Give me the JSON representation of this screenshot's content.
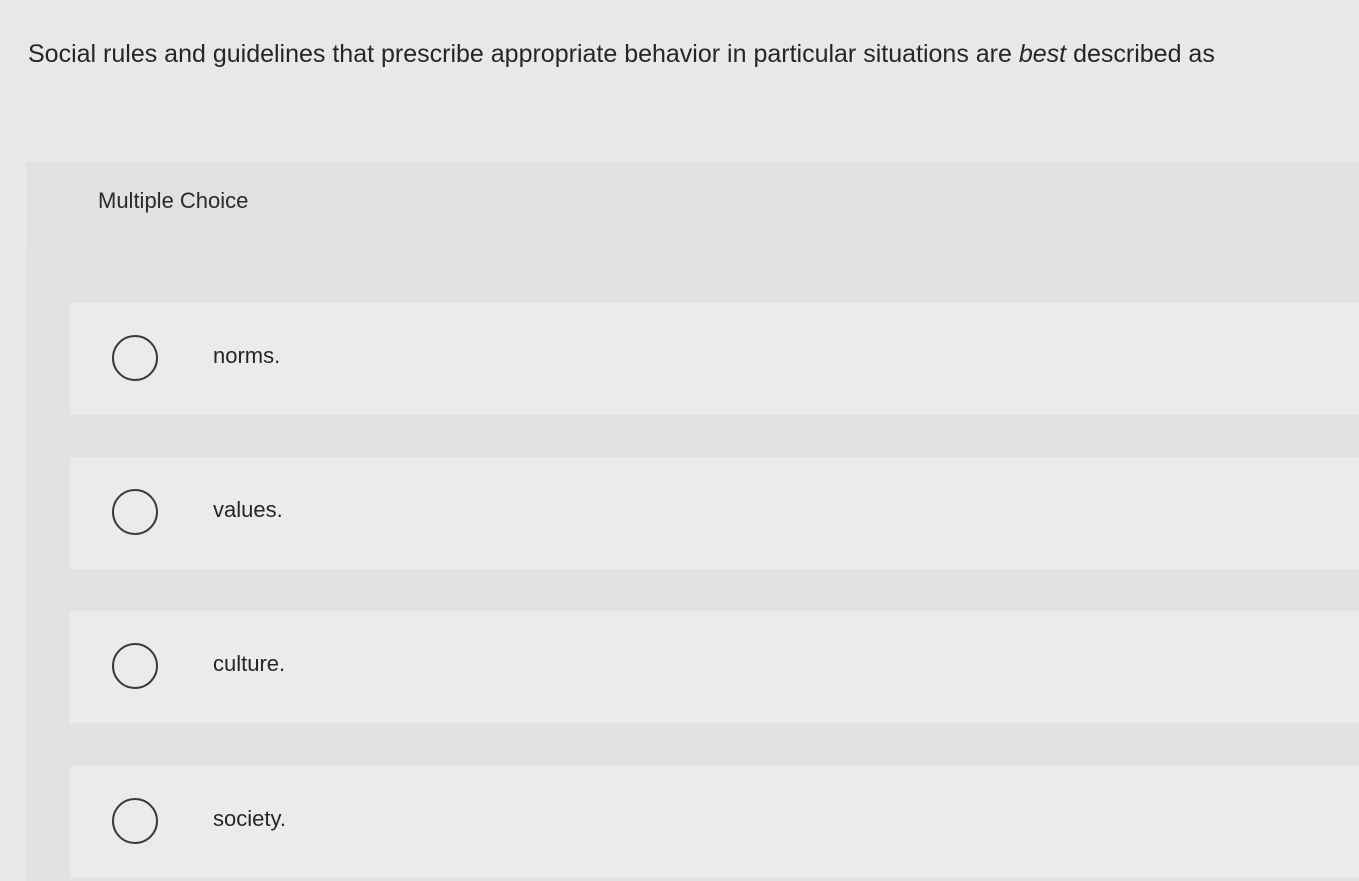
{
  "question": {
    "text_before": "Social rules and guidelines that prescribe appropriate behavior in particular situations are ",
    "emphasis": "best",
    "text_after": " described as"
  },
  "panel": {
    "label": "Multiple Choice"
  },
  "choices": [
    {
      "label": "norms.",
      "selected": false
    },
    {
      "label": "values.",
      "selected": false
    },
    {
      "label": "culture.",
      "selected": false
    },
    {
      "label": "society.",
      "selected": false
    }
  ]
}
